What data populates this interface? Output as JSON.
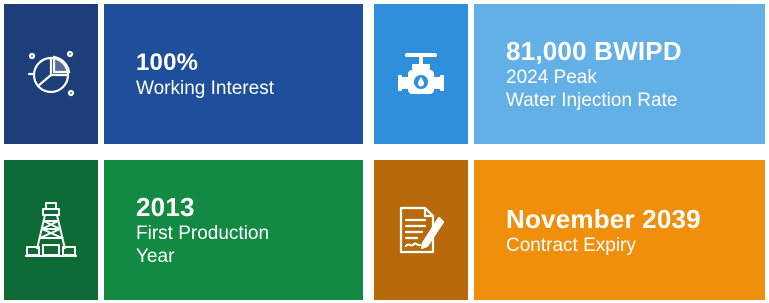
{
  "cards": [
    {
      "value": "100%",
      "label_lines": [
        "Working Interest"
      ],
      "icon": "pie-chart-icon"
    },
    {
      "value": "81,000 BWIPD",
      "label_lines": [
        "2024 Peak",
        "Water Injection Rate"
      ],
      "icon": "valve-icon"
    },
    {
      "value": "2013",
      "label_lines": [
        "First Production",
        "Year"
      ],
      "icon": "drilling-rig-icon"
    },
    {
      "value": "November 2039",
      "label_lines": [
        "Contract Expiry"
      ],
      "icon": "contract-document-icon"
    }
  ],
  "colors": {
    "navy_dark": "#1d3e78",
    "navy": "#1f4e9b",
    "sky_dark": "#2f8fdb",
    "sky": "#62b0e6",
    "green_dark": "#0e6b35",
    "green": "#138a44",
    "orange_dark": "#b8690b",
    "orange": "#ef8f0c"
  }
}
